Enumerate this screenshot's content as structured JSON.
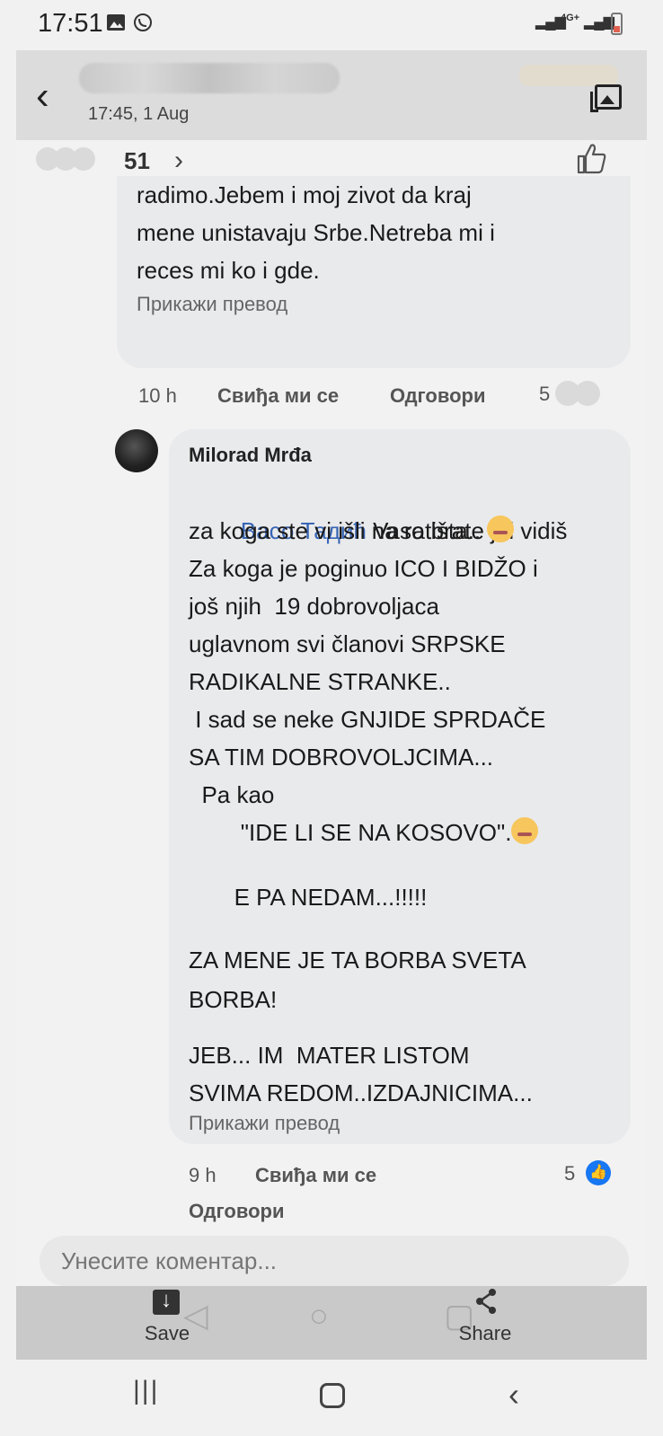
{
  "status_bar": {
    "time": "17:51",
    "network": "4G+"
  },
  "viewer": {
    "date": "17:45, 1 Aug",
    "actions": {
      "save_label": "Save",
      "share_label": "Share"
    }
  },
  "post": {
    "reaction_count": "51"
  },
  "comment1": {
    "text_lines": [
      "radimo.Jebem i moj zivot da kraj",
      "mene unistavaju Srbe.Netreba mi i",
      "reces mi ko i gde."
    ],
    "translate": "Прикажи превод",
    "time": "10 h",
    "like": "Свиђа ми се",
    "reply": "Одговори",
    "reactions": "5"
  },
  "comment2": {
    "author": "Milorad Mrđa",
    "mention": "Васо Тадић",
    "first_line_rest": " Vaso brate jel vidiš",
    "lines": [
      "za koga ste vi išli na ratišta..",
      "Za koga je poginuo ICO I BIDŽO i",
      "još njih  19 dobrovoljaca",
      "uglavnom svi članovi SRPSKE",
      "RADIKALNE STRANKE..",
      " I sad se neke GNJIDE SPRDAČE",
      "SA TIM DOBROVOLJCIMA...",
      "  Pa kao",
      "        \"IDE LI SE NA KOSOVO\".",
      "",
      "       E PA NEDAM...!!!!!",
      "",
      "ZA MENE JE TA BORBA SVETA",
      "BORBA!",
      "",
      "JEB... IM  MATER LISTOM",
      "SVIMA REDOM..IZDAJNICIMA..."
    ],
    "translate": "Прикажи превод",
    "time": "9 h",
    "like": "Свиђа ми се",
    "reply": "Одговори",
    "reactions": "5"
  },
  "input": {
    "placeholder": "Унесите коментар..."
  },
  "icons": {
    "back": "back-arrow-icon",
    "gallery": "gallery-icon",
    "like": "thumbs-up-icon",
    "save": "download-icon",
    "share": "share-icon"
  }
}
